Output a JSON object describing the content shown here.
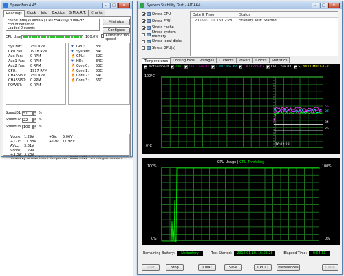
{
  "speedfan": {
    "title": "SpeedFan 4.45",
    "tabs": [
      "Readings",
      "Clock",
      "Info",
      "Exotics",
      "S.M.A.R.T.",
      "Charts"
    ],
    "log": [
      "Found Intel(R) Xeon(R) CPU E5450 @ 3.00GHz",
      "End of detection",
      "Loaded 0 events"
    ],
    "minimize": "Minimize",
    "configure": "Configure",
    "cpu_usage_label": "CPU Usage",
    "cpu_usage_value": "100.0%",
    "auto_fan_label": "Automatic fan speed",
    "fans": [
      {
        "name": "Sys Fan:",
        "value": "750 RPM"
      },
      {
        "name": "CPU Fan:",
        "value": "1918 RPM"
      },
      {
        "name": "Aux Fan:",
        "value": "0 RPM"
      },
      {
        "name": "Aux1 Fan:",
        "value": "0 RPM"
      },
      {
        "name": "Aux2 Fan:",
        "value": "0 RPM"
      },
      {
        "name": "CPU:",
        "value": "1917 RPM"
      },
      {
        "name": "CHASSIS1:",
        "value": "750 RPM"
      },
      {
        "name": "CHASSIS2:",
        "value": "0 RPM"
      },
      {
        "name": "POWER:",
        "value": "0 RPM"
      }
    ],
    "temps": [
      {
        "name": "GPU:",
        "value": "33C",
        "icon": "fan-down-icon"
      },
      {
        "name": "System:",
        "value": "34C",
        "icon": "fan-down-icon"
      },
      {
        "name": "CPU:",
        "value": "52C",
        "icon": "flame-icon"
      },
      {
        "name": "HD:",
        "value": "34C",
        "icon": "fan-down-icon"
      },
      {
        "name": "Core 0:",
        "value": "53C",
        "icon": "flame-icon"
      },
      {
        "name": "Core 1:",
        "value": "50C",
        "icon": "flame-icon"
      },
      {
        "name": "Core 2:",
        "value": "54C",
        "icon": "flame-icon"
      },
      {
        "name": "Core 3:",
        "value": "56C",
        "icon": "flame-icon"
      }
    ],
    "speeds": [
      {
        "name": "Speed01:",
        "value": "51",
        "unit": "%"
      },
      {
        "name": "Speed02:",
        "value": "22",
        "unit": "%"
      },
      {
        "name": "Speed03:",
        "value": "100",
        "unit": "%"
      }
    ],
    "volts_left": [
      {
        "name": "Vcore:",
        "value": "1.29V"
      },
      {
        "name": "+12V:",
        "value": "11.38V"
      },
      {
        "name": "AVcc:",
        "value": "3.31V"
      },
      {
        "name": "Vcore:",
        "value": "1.29V"
      },
      {
        "name": "+3.3V:",
        "value": "3.28V"
      }
    ],
    "volts_right": [
      {
        "name": "+5V:",
        "value": "5.06V"
      },
      {
        "name": "+12V:",
        "value": "11.98V"
      }
    ],
    "footer": "Coded by Alfredo Milani Comparetti - 2000-2011 - alfredo@almico.com"
  },
  "aida": {
    "title": "System Stability Test - AIDA64",
    "stress_items": [
      {
        "label": "Stress CPU",
        "checked": true
      },
      {
        "label": "Stress FPU",
        "checked": true
      },
      {
        "label": "Stress cache",
        "checked": true
      },
      {
        "label": "Stress system memory",
        "checked": false
      },
      {
        "label": "Stress local disks",
        "checked": false
      },
      {
        "label": "Stress GPU(s)",
        "checked": false
      }
    ],
    "table_headers": [
      "Date & Time",
      "Status"
    ],
    "table_row": {
      "datetime": "2016.01.10. 16:02:28",
      "status": "Stability Test: Started"
    },
    "tabs": [
      "Temperatures",
      "Cooling Fans",
      "Voltages",
      "Currents",
      "Powers",
      "Clocks",
      "Statistics"
    ],
    "legend": [
      {
        "label": "Motherboard",
        "color": "#ffffff"
      },
      {
        "label": "CPU",
        "color": "#00ff00"
      },
      {
        "label": "CPU Core #1",
        "color": "#ff00ff"
      },
      {
        "label": "CPU Core #2",
        "color": "#00ffff"
      },
      {
        "label": "CPU Core #3",
        "color": "#ff40ff"
      },
      {
        "label": "CPU Core #4",
        "color": "#ffffff"
      },
      {
        "label": "ST2000DM001-1ER1",
        "color": "#ffff00"
      }
    ],
    "temp_chart": {
      "ymax_label": "100°C",
      "ymin_label": "0°C",
      "time_label": "16:02:28",
      "end_values": [
        "55",
        "52",
        "34",
        "25"
      ]
    },
    "usage_chart": {
      "title_a": "CPU Usage",
      "title_sep": "|",
      "title_b": "CPU Throttling",
      "left_top": "100%",
      "left_bottom": "0%",
      "right_top": "100%",
      "right_bottom": "0%"
    },
    "status": {
      "battery_label": "Remaining Battery:",
      "battery_value": "No battery",
      "started_label": "Test Started:",
      "started_value": "2016.01.10. 16:02:28",
      "elapsed_label": "Elapsed Time:",
      "elapsed_value": "0:04:11"
    },
    "buttons": [
      "Start",
      "Stop",
      "Clear",
      "Save",
      "CPUID",
      "Preferences",
      "Close"
    ],
    "colors": {
      "chart_bg": "#000000",
      "grid": "#1f6e1f",
      "usage": "#00ff00",
      "status_bg": "#000000",
      "status_fg": "#00ff00"
    }
  }
}
